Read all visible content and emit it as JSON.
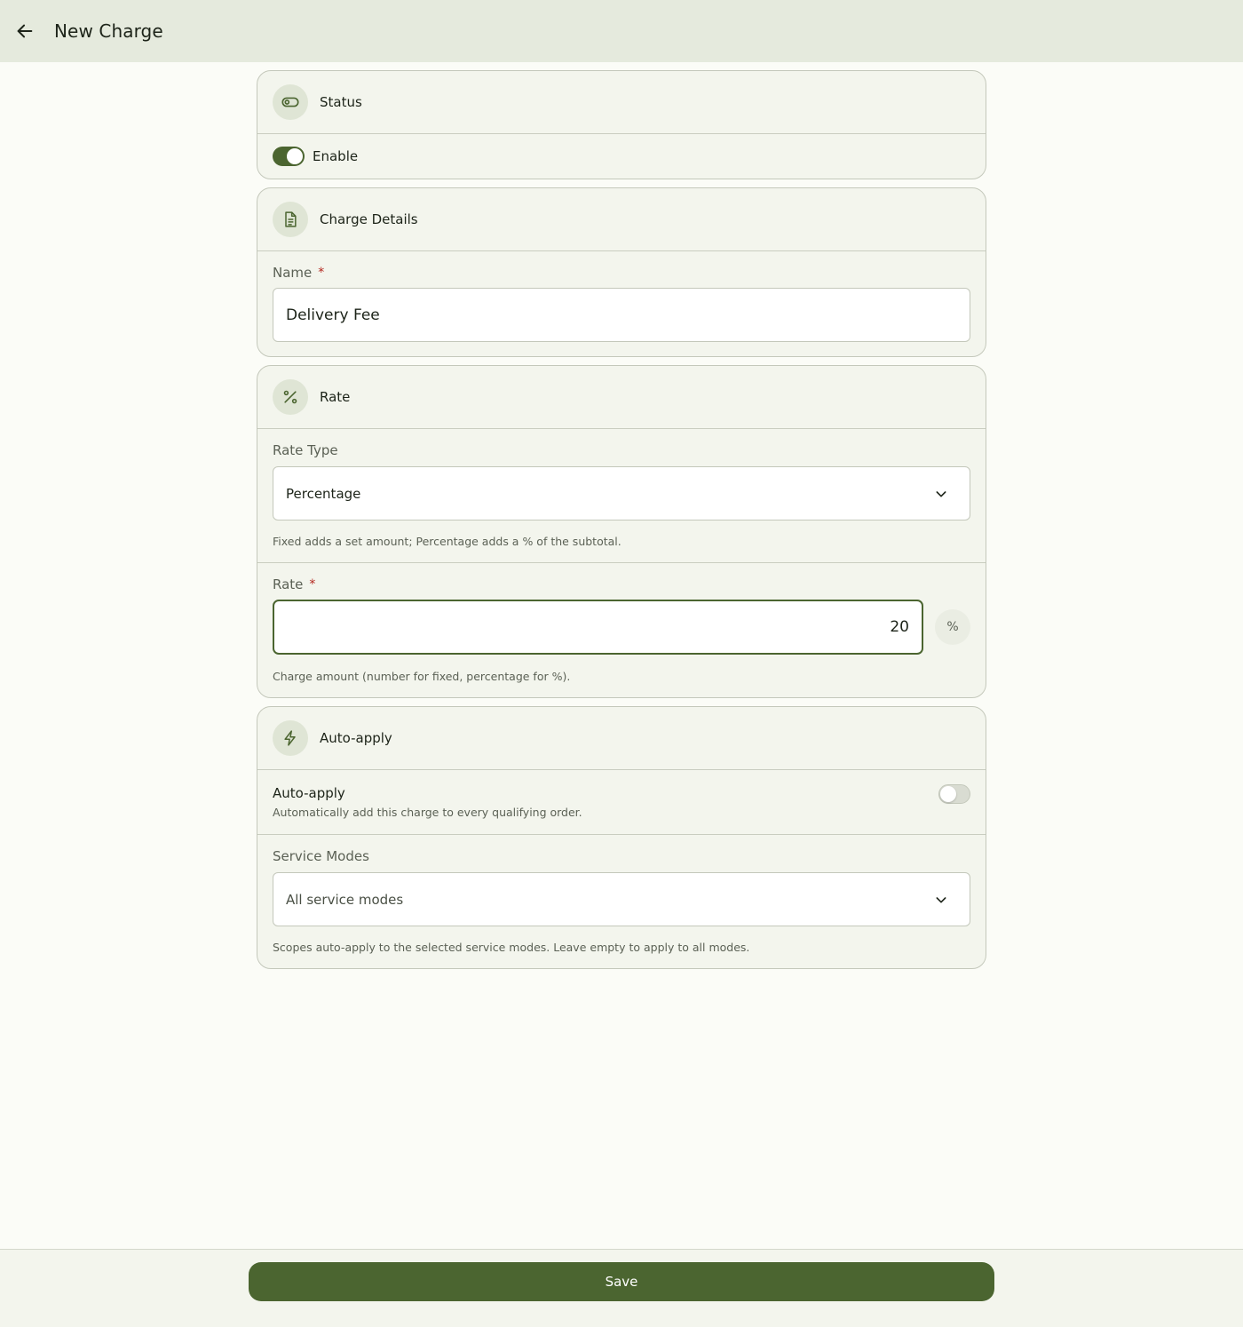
{
  "header": {
    "title": "New Charge",
    "back_icon": "arrow-left-icon"
  },
  "status": {
    "title": "Status",
    "icon": "toggle-icon",
    "enable_label": "Enable",
    "enabled": true
  },
  "details": {
    "title": "Charge Details",
    "icon": "document-icon",
    "name_label": "Name",
    "name_required": "*",
    "name_value": "Delivery Fee"
  },
  "rate": {
    "title": "Rate",
    "icon": "percent-icon",
    "type_label": "Rate Type",
    "type_value": "Percentage",
    "type_helper": "Fixed adds a set amount; Percentage adds a % of the subtotal.",
    "rate_label": "Rate",
    "rate_required": "*",
    "rate_value": "20",
    "rate_suffix": "%",
    "rate_helper": "Charge amount (number for fixed, percentage for %)."
  },
  "auto": {
    "title": "Auto-apply",
    "icon": "lightning-icon",
    "toggle_label": "Auto-apply",
    "toggle_desc": "Automatically add this charge to every qualifying order.",
    "toggle_on": false,
    "modes_label": "Service Modes",
    "modes_placeholder": "All service modes",
    "modes_helper": "Scopes auto-apply to the selected service modes. Leave empty to apply to all modes."
  },
  "footer": {
    "save_label": "Save"
  },
  "colors": {
    "accent": "#4b6530",
    "appbar": "#e5eadd",
    "required": "#b3261e"
  }
}
